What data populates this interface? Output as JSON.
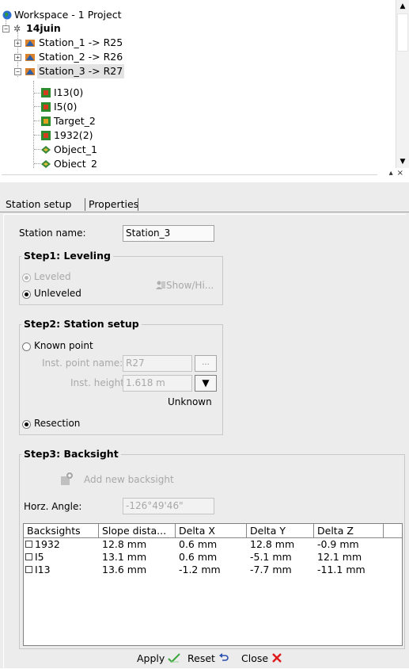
{
  "tree": {
    "root_label": "Workspace - 1 Project",
    "project_label": "14juin",
    "stations": [
      {
        "label": "Station_1 -> R25"
      },
      {
        "label": "Station_2 -> R26"
      },
      {
        "label": "Station_3 -> R27"
      }
    ],
    "children": [
      {
        "label": "I13(0)"
      },
      {
        "label": "I5(0)"
      },
      {
        "label": "Target_2"
      },
      {
        "label": "1932(2)"
      },
      {
        "label": "Object_1"
      },
      {
        "label": "Object_2"
      }
    ]
  },
  "tabs": [
    {
      "label": "Station setup"
    },
    {
      "label": "Properties"
    }
  ],
  "station": {
    "name_label": "Station name:",
    "name_value": "Station_3"
  },
  "step1": {
    "title": "Step1: Leveling",
    "leveled": "Leveled",
    "unleveled": "Unleveled",
    "show_hide": "Show/Hi..."
  },
  "step2": {
    "title": "Step2: Station setup",
    "known_point": "Known point",
    "inst_point_label": "Inst. point name:",
    "inst_point_value": "R27",
    "browse": "...",
    "inst_height_label": "Inst. height:",
    "inst_height_value": "1.618 m",
    "unknown": "Unknown",
    "resection": "Resection"
  },
  "step3": {
    "title": "Step3: Backsight",
    "add_backsight": "Add new backsight",
    "horz_label": "Horz. Angle:",
    "horz_value": "-126°49'46\""
  },
  "table": {
    "headers": [
      "Backsights",
      "Slope dista...",
      "Delta X",
      "Delta Y",
      "Delta Z"
    ],
    "rows": [
      {
        "name": "1932",
        "slope": "12.8 mm",
        "dx": "0.6 mm",
        "dy": "12.8 mm",
        "dz": "-0.9 mm"
      },
      {
        "name": "I5",
        "slope": "13.1 mm",
        "dx": "0.6 mm",
        "dy": "-5.1 mm",
        "dz": "12.1 mm"
      },
      {
        "name": "I13",
        "slope": "13.6 mm",
        "dx": "-1.2 mm",
        "dy": "-7.7 mm",
        "dz": "-11.1 mm"
      }
    ]
  },
  "footer": {
    "apply": "Apply",
    "reset": "Reset",
    "close": "Close"
  },
  "colors": {
    "apply_check": "#3aa63a",
    "close_x": "#e01818"
  }
}
